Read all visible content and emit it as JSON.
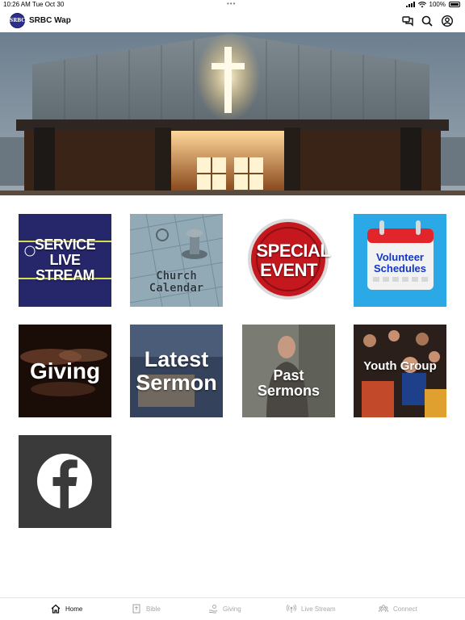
{
  "status_bar": {
    "time": "10:26 AM",
    "date": "Tue Oct 30",
    "battery": "100%"
  },
  "header": {
    "app_title": "SRBC Wap",
    "logo_text": "SRBC"
  },
  "tiles": [
    {
      "label": "SERVICE LIVE STREAM"
    },
    {
      "label": "Church Calendar"
    },
    {
      "label": "SPECIAL EVENT"
    },
    {
      "label": "Volunteer Schedules"
    },
    {
      "label": "Giving"
    },
    {
      "label": "Latest Sermon"
    },
    {
      "label": "Past Sermons"
    },
    {
      "label": "Youth Group"
    },
    {
      "label": "",
      "icon": "facebook-icon"
    }
  ],
  "tab_bar": {
    "items": [
      {
        "label": "Home",
        "icon": "home-icon",
        "active": true
      },
      {
        "label": "Bible",
        "icon": "bible-icon",
        "active": false
      },
      {
        "label": "Giving",
        "icon": "giving-icon",
        "active": false
      },
      {
        "label": "Live Stream",
        "icon": "live-stream-icon",
        "active": false
      },
      {
        "label": "Connect",
        "icon": "connect-icon",
        "active": false
      }
    ]
  },
  "colors": {
    "accent": "#2b2f8f",
    "tab_active": "#111111",
    "tab_inactive": "#a8a8a8"
  }
}
